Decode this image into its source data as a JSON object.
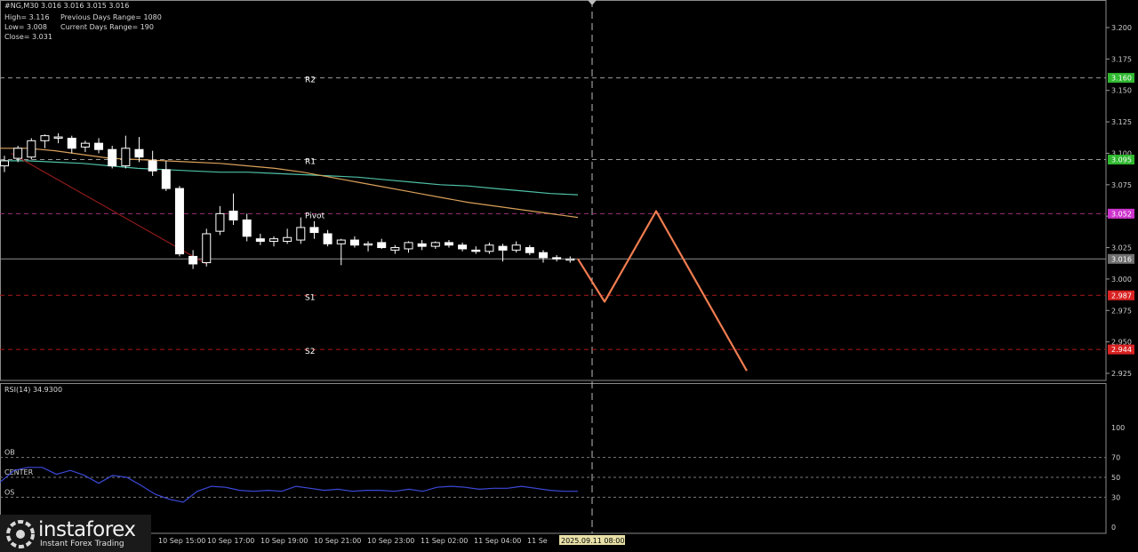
{
  "header": {
    "symbol": "#NG,M30  3.016 3.016 3.015 3.016",
    "high": "High= 3.116",
    "low": "Low= 3.008",
    "close": "Close= 3.031",
    "prev_range": "Previous Days Range= 1080",
    "curr_range": "Current Days Range= 190"
  },
  "chart_data": [
    {
      "type": "candlestick",
      "price_axis_ticks": [
        "3.200",
        "3.175",
        "3.150",
        "3.125",
        "3.100",
        "3.075",
        "3.050",
        "3.025",
        "3.000",
        "2.975",
        "2.950",
        "2.925"
      ],
      "ylim": [
        2.92,
        3.215
      ],
      "time_labels": [
        "10 Sep 15:00",
        "10 Sep 17:00",
        "10 Sep 19:00",
        "10 Sep 21:00",
        "10 Sep 23:00",
        "11 Sep 02:00",
        "11 Sep 04:00",
        "11 Se",
        "2025.09.11 08:00"
      ],
      "candles": [
        {
          "o": 3.09,
          "h": 3.098,
          "l": 3.085,
          "c": 3.094
        },
        {
          "o": 3.096,
          "h": 3.106,
          "l": 3.093,
          "c": 3.104
        },
        {
          "o": 3.097,
          "h": 3.112,
          "l": 3.095,
          "c": 3.11
        },
        {
          "o": 3.11,
          "h": 3.115,
          "l": 3.104,
          "c": 3.114
        },
        {
          "o": 3.112,
          "h": 3.116,
          "l": 3.108,
          "c": 3.113
        },
        {
          "o": 3.112,
          "h": 3.114,
          "l": 3.1,
          "c": 3.104
        },
        {
          "o": 3.105,
          "h": 3.11,
          "l": 3.101,
          "c": 3.108
        },
        {
          "o": 3.108,
          "h": 3.112,
          "l": 3.1,
          "c": 3.103
        },
        {
          "o": 3.103,
          "h": 3.106,
          "l": 3.088,
          "c": 3.09
        },
        {
          "o": 3.09,
          "h": 3.114,
          "l": 3.088,
          "c": 3.104
        },
        {
          "o": 3.103,
          "h": 3.113,
          "l": 3.093,
          "c": 3.097
        },
        {
          "o": 3.094,
          "h": 3.102,
          "l": 3.082,
          "c": 3.086
        },
        {
          "o": 3.087,
          "h": 3.094,
          "l": 3.07,
          "c": 3.072
        },
        {
          "o": 3.072,
          "h": 3.074,
          "l": 3.018,
          "c": 3.02
        },
        {
          "o": 3.018,
          "h": 3.023,
          "l": 3.008,
          "c": 3.012
        },
        {
          "o": 3.013,
          "h": 3.04,
          "l": 3.01,
          "c": 3.036
        },
        {
          "o": 3.038,
          "h": 3.058,
          "l": 3.035,
          "c": 3.052
        },
        {
          "o": 3.054,
          "h": 3.068,
          "l": 3.043,
          "c": 3.047
        },
        {
          "o": 3.047,
          "h": 3.052,
          "l": 3.03,
          "c": 3.034
        },
        {
          "o": 3.032,
          "h": 3.036,
          "l": 3.027,
          "c": 3.03
        },
        {
          "o": 3.03,
          "h": 3.034,
          "l": 3.026,
          "c": 3.032
        },
        {
          "o": 3.03,
          "h": 3.04,
          "l": 3.028,
          "c": 3.033
        },
        {
          "o": 3.031,
          "h": 3.049,
          "l": 3.028,
          "c": 3.041
        },
        {
          "o": 3.041,
          "h": 3.046,
          "l": 3.032,
          "c": 3.037
        },
        {
          "o": 3.036,
          "h": 3.039,
          "l": 3.026,
          "c": 3.028
        },
        {
          "o": 3.028,
          "h": 3.032,
          "l": 3.011,
          "c": 3.031
        },
        {
          "o": 3.031,
          "h": 3.034,
          "l": 3.025,
          "c": 3.027
        },
        {
          "o": 3.027,
          "h": 3.03,
          "l": 3.022,
          "c": 3.028
        },
        {
          "o": 3.029,
          "h": 3.032,
          "l": 3.024,
          "c": 3.025
        },
        {
          "o": 3.023,
          "h": 3.027,
          "l": 3.02,
          "c": 3.025
        },
        {
          "o": 3.024,
          "h": 3.03,
          "l": 3.021,
          "c": 3.029
        },
        {
          "o": 3.028,
          "h": 3.031,
          "l": 3.023,
          "c": 3.026
        },
        {
          "o": 3.026,
          "h": 3.03,
          "l": 3.024,
          "c": 3.029
        },
        {
          "o": 3.029,
          "h": 3.031,
          "l": 3.025,
          "c": 3.027
        },
        {
          "o": 3.027,
          "h": 3.029,
          "l": 3.022,
          "c": 3.024
        },
        {
          "o": 3.023,
          "h": 3.026,
          "l": 3.02,
          "c": 3.022
        },
        {
          "o": 3.022,
          "h": 3.029,
          "l": 3.02,
          "c": 3.027
        },
        {
          "o": 3.026,
          "h": 3.028,
          "l": 3.014,
          "c": 3.023
        },
        {
          "o": 3.023,
          "h": 3.03,
          "l": 3.021,
          "c": 3.027
        },
        {
          "o": 3.025,
          "h": 3.027,
          "l": 3.019,
          "c": 3.021
        },
        {
          "o": 3.021,
          "h": 3.023,
          "l": 3.013,
          "c": 3.017
        },
        {
          "o": 3.017,
          "h": 3.019,
          "l": 3.014,
          "c": 3.016
        },
        {
          "o": 3.015,
          "h": 3.018,
          "l": 3.013,
          "c": 3.016
        }
      ],
      "levels": [
        {
          "label": "R2",
          "value": 3.16,
          "axis_label": "3.160",
          "color": "#2fb82f"
        },
        {
          "label": "R1",
          "value": 3.095,
          "axis_label": "3.095",
          "color": "#2fb82f"
        },
        {
          "label": "Pivot",
          "value": 3.052,
          "axis_label": "3.052",
          "color": "#cc33cc"
        },
        {
          "label": "",
          "value": 3.016,
          "axis_label": "3.016",
          "color": "#707070"
        },
        {
          "label": "S1",
          "value": 2.987,
          "axis_label": "2.987",
          "color": "#d92222"
        },
        {
          "label": "S2",
          "value": 2.944,
          "axis_label": "2.944",
          "color": "#d92222"
        }
      ],
      "ma_slow": [
        3.094,
        3.094,
        3.093,
        3.092,
        3.09,
        3.088,
        3.087,
        3.086,
        3.085,
        3.085,
        3.084,
        3.083,
        3.082,
        3.081,
        3.079,
        3.077,
        3.075,
        3.074,
        3.072,
        3.07,
        3.068,
        3.067
      ],
      "ma_fast": [
        3.104,
        3.104,
        3.102,
        3.099,
        3.096,
        3.095,
        3.094,
        3.093,
        3.092,
        3.09,
        3.088,
        3.085,
        3.081,
        3.077,
        3.073,
        3.069,
        3.065,
        3.061,
        3.058,
        3.055,
        3.052,
        3.049
      ],
      "trend_line": [
        {
          "i": 0.5,
          "v": 3.1
        },
        {
          "i": 15,
          "v": 3.012
        }
      ],
      "forecast": [
        3.016,
        2.982,
        3.054,
        2.927
      ],
      "grid": true
    },
    {
      "type": "line",
      "title": "RSI(14) 34.9300",
      "ylim": [
        0,
        100
      ],
      "levels": [
        {
          "label": "OB",
          "value": 70
        },
        {
          "label": "CENTER",
          "value": 50
        },
        {
          "label": "OS",
          "value": 30
        }
      ],
      "tick_labels": [
        "100",
        "70",
        "50",
        "30",
        "0"
      ],
      "values": [
        45,
        57,
        60,
        60,
        53,
        57,
        52,
        44,
        52,
        50,
        42,
        33,
        28,
        25,
        36,
        41,
        40,
        37,
        36,
        37,
        36,
        41,
        39,
        37,
        38,
        36,
        37,
        37,
        36,
        38,
        36,
        40,
        41,
        40,
        38,
        39,
        39,
        41,
        39,
        37,
        36,
        36
      ]
    }
  ],
  "logo": {
    "name": "instaforex",
    "tagline": "Instant Forex Trading"
  },
  "colors": {
    "bg": "#000000",
    "candle": "#ffffff",
    "ma_slow": "#4fc1a6",
    "ma_fast": "#d9a05a",
    "trend": "#8b1a1a",
    "forecast": "#f07c50",
    "rsi": "#3b49d8",
    "grid": "#5a5a5a"
  }
}
